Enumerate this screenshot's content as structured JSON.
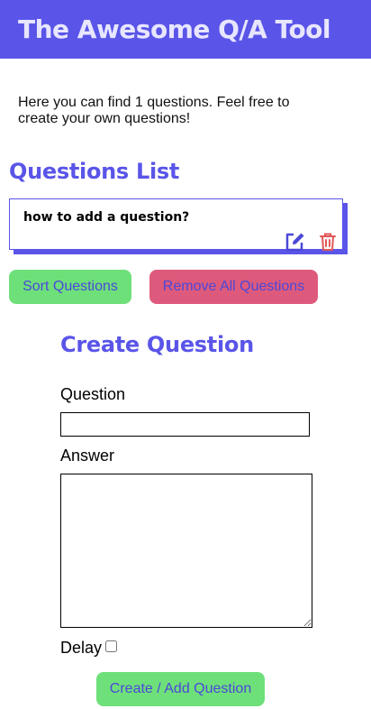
{
  "header": {
    "title": "The Awesome Q/A Tool"
  },
  "intro": {
    "text": "Here you can find 1 questions. Feel free to create your own questions!"
  },
  "questions_list": {
    "title": "Questions List",
    "items": [
      {
        "question": "how to add a question?"
      }
    ],
    "edit_icon": "edit-icon",
    "delete_icon": "trash-icon"
  },
  "actions": {
    "sort_label": "Sort Questions",
    "remove_all_label": "Remove All Questions"
  },
  "create_form": {
    "title": "Create Question",
    "question_label": "Question",
    "question_value": "",
    "answer_label": "Answer",
    "answer_value": "",
    "delay_label": "Delay",
    "delay_checked": false,
    "submit_label": "Create / Add Question"
  },
  "colors": {
    "brand": "#5a55e8",
    "success": "#6ee07a",
    "danger": "#de5a7c",
    "button_text": "#4b48d8"
  }
}
